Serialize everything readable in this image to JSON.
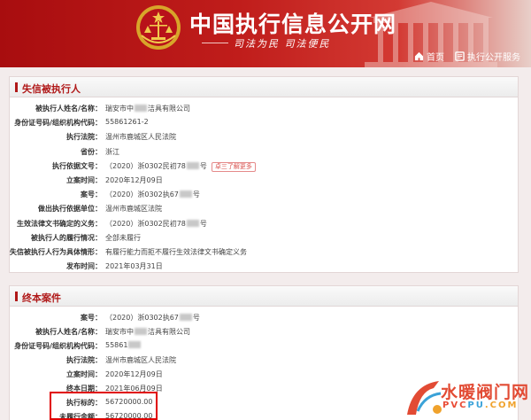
{
  "header": {
    "site_title": "中国执行信息公开网",
    "slogan": "司法为民  司法便民",
    "nav": [
      {
        "label": "首页",
        "icon": "home-icon"
      },
      {
        "label": "执行公开服务",
        "icon": "service-icon"
      }
    ]
  },
  "dishonest_panel": {
    "title": "失信被执行人",
    "rows": [
      {
        "label": "被执行人姓名/名称：",
        "value": "瑞安市中",
        "blur": true,
        "suffix": "洁具有限公司"
      },
      {
        "label": "身份证号码/组织机构代码：",
        "value": "55861261-2"
      },
      {
        "label": "执行法院：",
        "value": "温州市鹿城区人民法院"
      },
      {
        "label": "省份：",
        "value": "浙江"
      },
      {
        "label": "执行依据文号：",
        "value": "（2020）浙0302民初78",
        "blur": true,
        "suffix": "号",
        "tag": "卓三了解更多"
      },
      {
        "label": "立案时间：",
        "value": "2020年12月09日"
      },
      {
        "label": "案号：",
        "value": "（2020）浙0302执67",
        "blur": true,
        "suffix": "号"
      },
      {
        "label": "做出执行依据单位：",
        "value": "温州市鹿城区法院"
      },
      {
        "label": "生效法律文书确定的义务：",
        "value": "（2020）浙0302民初78",
        "blur": true,
        "suffix": "号"
      },
      {
        "label": "被执行人的履行情况：",
        "value": "全部未履行"
      },
      {
        "label": "失信被执行人行为具体情形：",
        "value": "有履行能力而拒不履行生效法律文书确定义务"
      },
      {
        "label": "发布时间：",
        "value": "2021年03月31日"
      }
    ]
  },
  "final_panel": {
    "title": "终本案件",
    "rows": [
      {
        "label": "案号：",
        "value": "（2020）浙0302执67",
        "blur": true,
        "suffix": "号"
      },
      {
        "label": "被执行人姓名/名称：",
        "value": "瑞安市中",
        "blur": true,
        "suffix": "洁具有限公司"
      },
      {
        "label": "身份证号码/组织机构代码：",
        "value": "55861",
        "blur": true,
        "suffix": ""
      },
      {
        "label": "执行法院：",
        "value": "温州市鹿城区人民法院"
      },
      {
        "label": "立案时间：",
        "value": "2020年12月09日"
      },
      {
        "label": "终本日期：",
        "value": "2021年06月09日"
      },
      {
        "label": "执行标的：",
        "value": "56720000.00"
      },
      {
        "label": "未履行金额：",
        "value": "56720000.00"
      }
    ]
  },
  "watermark": {
    "name": "水暖阀门网",
    "domain_parts": [
      "PVC",
      "PU",
      ".COM"
    ]
  }
}
